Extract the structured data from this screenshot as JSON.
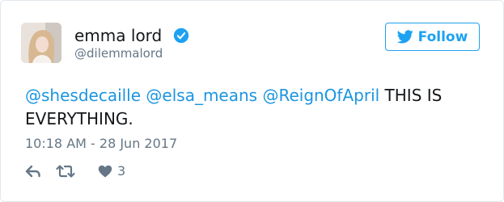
{
  "user": {
    "display_name": "emma lord",
    "handle": "@dilemmalord"
  },
  "follow_button": {
    "label": "Follow"
  },
  "tweet": {
    "mentions": [
      "@shesdecaille",
      "@elsa_means",
      "@ReignOfApril"
    ],
    "text": "THIS IS EVERYTHING.",
    "timestamp": "10:18 AM - 28 Jun 2017"
  },
  "actions": {
    "reply_icon": "reply-icon",
    "retweet_icon": "retweet-icon",
    "like_icon": "heart-icon",
    "like_count": "3"
  },
  "colors": {
    "accent": "#1da1f2",
    "link": "#1b95e0",
    "muted": "#657786",
    "border": "#e1e8ed",
    "text": "#14171a"
  }
}
